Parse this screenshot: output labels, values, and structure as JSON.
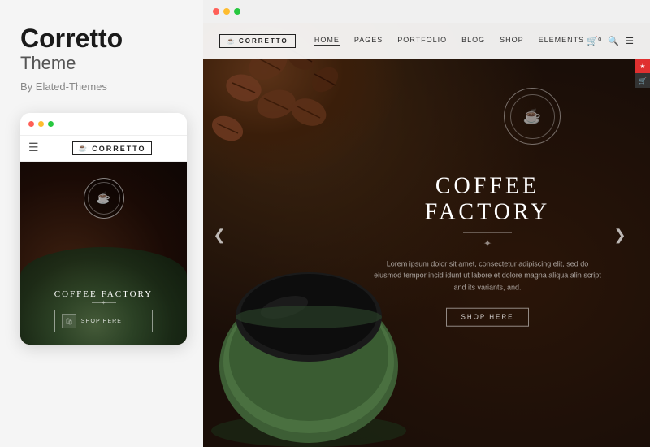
{
  "left": {
    "title": "Corretto",
    "subtitle": "Theme",
    "by": "By Elated-Themes",
    "mobile": {
      "logo": "CORRETTO",
      "hero_title": "COFFEE FACTORY",
      "shop_btn": "shop HeRE"
    }
  },
  "right": {
    "browser_dots": [
      "#ff5f57",
      "#febc2e",
      "#28c840"
    ],
    "nav": {
      "logo": "CORRETTO",
      "links": [
        "HOME",
        "PAGES",
        "PORTFOLIO",
        "BLOG",
        "SHOP",
        "ELEMENTS"
      ],
      "active": "HOME"
    },
    "hero": {
      "title": "COFFEE FACTORY",
      "body": "Lorem ipsum dolor sit amet, consectetur adipiscing elit, sed do eiusmod tempor incid idunt ut labore et dolore magna aliqua alin script and its variants, and.",
      "shop_btn": "SHOP HERE"
    },
    "arrows": {
      "left": "❮",
      "right": "❯"
    }
  }
}
